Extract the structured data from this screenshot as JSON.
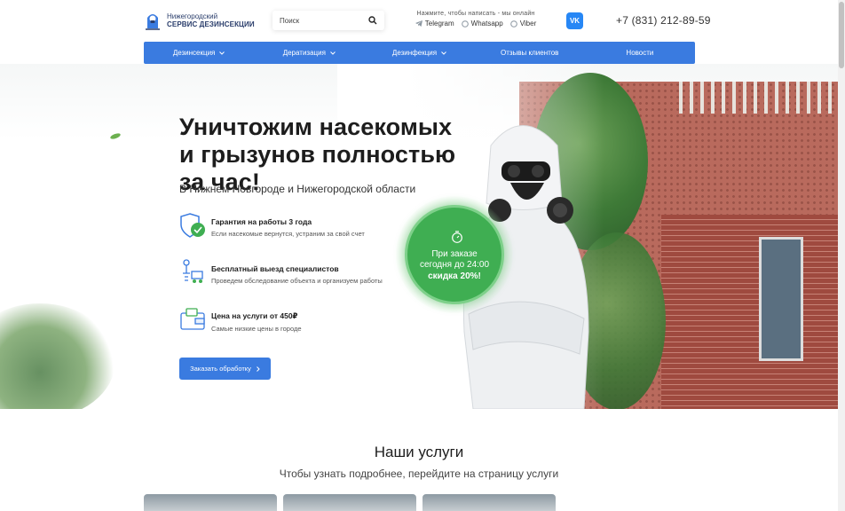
{
  "header": {
    "logo_line1": "Нижегородский",
    "logo_line2": "СЕРВИС ДЕЗИНСЕКЦИИ",
    "search_placeholder": "Поиск",
    "messengers_hint": "Нажмите, чтобы написать - мы онлайн",
    "messengers": [
      "Telegram",
      "Whatsapp",
      "Viber"
    ],
    "vk_label": "VK",
    "phone": "+7 (831) 212-89-59"
  },
  "nav": {
    "items": [
      {
        "label": "Дезинсекция"
      },
      {
        "label": "Дератизация"
      },
      {
        "label": "Дезинфекция"
      },
      {
        "label": "Отзывы клиентов"
      },
      {
        "label": "Новости"
      }
    ]
  },
  "hero": {
    "title": "Уничтожим насекомых и грызунов полностью за час!",
    "subtitle": "В Нижнем Новгороде и Нижегородской области",
    "features": [
      {
        "title": "Гарантия на работы 3 года",
        "desc": "Если насекомые вернутся, устраним за свой счет",
        "icon": "shield-check-icon"
      },
      {
        "title": "Бесплатный выезд специалистов",
        "desc": "Проведем обследование объекта и организуем работы",
        "icon": "specialist-route-icon"
      },
      {
        "title": "Цена на услуги от 450₽",
        "desc": "Самые низкие цены в городе",
        "icon": "price-wallet-icon"
      }
    ],
    "cta_label": "Заказать обработку",
    "promo": {
      "line1": "При заказе",
      "line2": "сегодня до 24:00",
      "line3": "скидка 20%!"
    }
  },
  "services": {
    "title": "Наши услуги",
    "subtitle": "Чтобы узнать подробнее, перейдите на страницу услуги"
  },
  "colors": {
    "accent": "#3a7be0",
    "promo_green": "#3fae52",
    "vk_blue": "#2787f5"
  }
}
